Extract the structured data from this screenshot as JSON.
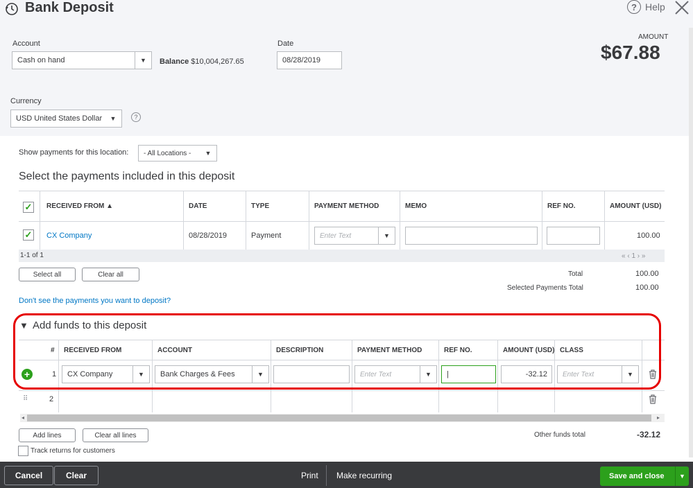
{
  "header": {
    "title": "Bank Deposit",
    "help_label": "Help",
    "account_label": "Account",
    "account_value": "Cash on hand",
    "balance_label": "Balance",
    "balance_value": "$10,004,267.65",
    "date_label": "Date",
    "date_value": "08/28/2019",
    "amount_label": "AMOUNT",
    "amount_value": "$67.88",
    "currency_label": "Currency",
    "currency_value": "USD United States Dollar"
  },
  "filter": {
    "label": "Show payments for this location:",
    "value": "- All Locations -"
  },
  "payments": {
    "heading": "Select the payments included in this deposit",
    "columns": [
      "RECEIVED FROM ▲",
      "DATE",
      "TYPE",
      "PAYMENT METHOD",
      "MEMO",
      "REF NO.",
      "AMOUNT (USD)"
    ],
    "rows": [
      {
        "received_from": "CX Company",
        "date": "08/28/2019",
        "type": "Payment",
        "payment_method_placeholder": "Enter Text",
        "memo": "",
        "ref_no": "",
        "amount": "100.00"
      }
    ],
    "pagination": "1-1 of 1",
    "pager": "« ‹ 1 › »",
    "select_all": "Select all",
    "clear_all": "Clear all",
    "total_label": "Total",
    "total_value": "100.00",
    "selected_total_label": "Selected Payments Total",
    "selected_total_value": "100.00",
    "missing_link": "Don't see the payments you want to deposit?"
  },
  "funds": {
    "heading": "Add funds to this deposit",
    "columns": [
      "#",
      "RECEIVED FROM",
      "ACCOUNT",
      "DESCRIPTION",
      "PAYMENT METHOD",
      "REF NO.",
      "AMOUNT (USD)",
      "CLASS"
    ],
    "rows": [
      {
        "num": "1",
        "received_from": "CX Company",
        "account": "Bank Charges & Fees",
        "description": "",
        "payment_method_placeholder": "Enter Text",
        "ref_no": "|",
        "amount": "-32.12",
        "class_placeholder": "Enter Text"
      },
      {
        "num": "2"
      }
    ],
    "add_lines": "Add lines",
    "clear_all_lines": "Clear all lines",
    "other_total_label": "Other funds total",
    "other_total_value": "-32.12",
    "track_returns": "Track returns for customers"
  },
  "footer": {
    "cancel": "Cancel",
    "clear": "Clear",
    "print": "Print",
    "make_recurring": "Make recurring",
    "save_close": "Save and close"
  },
  "colors": {
    "accent_green": "#2ca01c",
    "link_blue": "#0077c5",
    "highlight_red": "#e60000",
    "footer_bg": "#393a3d"
  }
}
